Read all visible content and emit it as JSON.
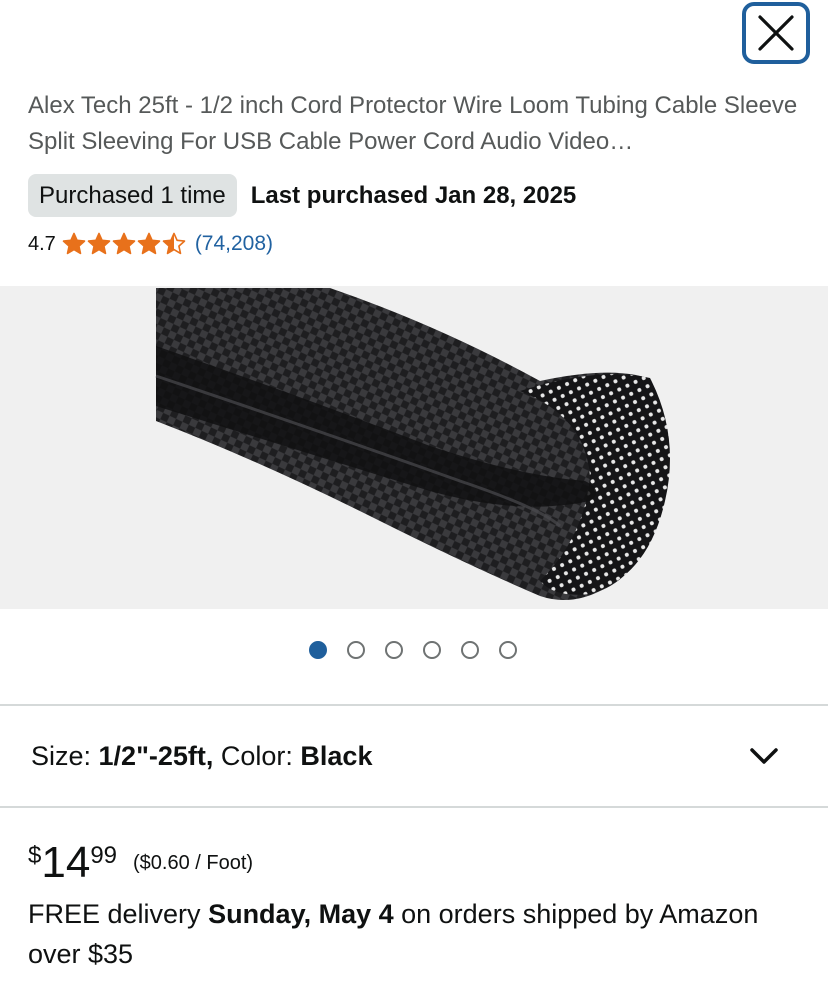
{
  "close": {
    "icon": "close-icon"
  },
  "product": {
    "title": "Alex Tech 25ft - 1/2 inch Cord Protector Wire Loom Tubing Cable Sleeve Split Sleeving For USB Cable Power Cord Audio Video…",
    "purchased_badge": "Purchased 1 time",
    "last_purchased": "Last purchased Jan 28, 2025",
    "rating": {
      "value": "4.7",
      "stars": 4.5,
      "count": "(74,208)",
      "star_color": "#e8711b"
    }
  },
  "gallery": {
    "image": "black braided cable sleeve",
    "total": 6,
    "active_index": 0,
    "accent": "#1f5f9c"
  },
  "variant": {
    "size_label": "Size: ",
    "size_value": "1/2\"-25ft,",
    "color_label": " Color: ",
    "color_value": "Black",
    "icon": "chevron-down-icon"
  },
  "price": {
    "currency": "$",
    "whole": "14",
    "fraction": "99",
    "unit_price": "($0.60 / Foot)"
  },
  "delivery": {
    "prefix": "FREE delivery ",
    "date": "Sunday, May 4",
    "suffix": " on orders shipped by Amazon over $35"
  }
}
